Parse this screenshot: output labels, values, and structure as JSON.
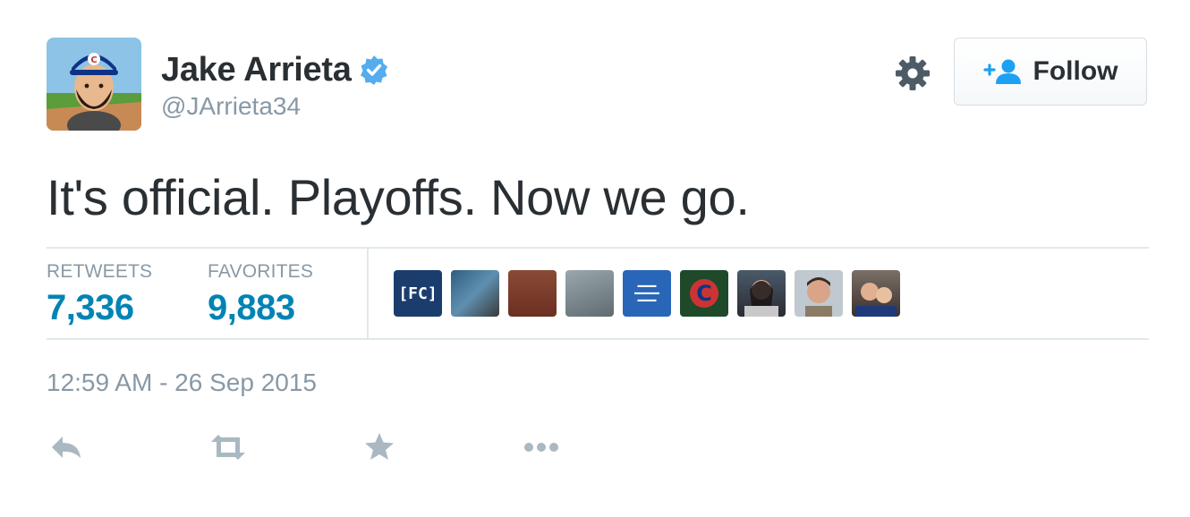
{
  "user": {
    "name": "Jake Arrieta",
    "handle": "@JArrieta34",
    "verified": true,
    "avatar_icon": "cartoon-baseball-player-avatar"
  },
  "header": {
    "settings_icon": "gear-icon",
    "follow_label": "Follow",
    "follow_icon": "add-user-icon"
  },
  "tweet": {
    "text": "It's official. Playoffs. Now we go."
  },
  "stats": {
    "retweets_label": "RETWEETS",
    "retweets_value": "7,336",
    "favorites_label": "FAVORITES",
    "favorites_value": "9,883"
  },
  "favoriters": [
    {
      "icon": "fantasy-cruncher-logo",
      "text": "[FC]",
      "color": "#1b3d6e"
    },
    {
      "icon": "user-photo",
      "color": "#3d6f8f"
    },
    {
      "icon": "user-photo",
      "color": "#7a3d2b"
    },
    {
      "icon": "user-photo",
      "color": "#6f7f86"
    },
    {
      "icon": "quote-poster",
      "color": "#2a66b8"
    },
    {
      "icon": "cubs-logo",
      "text": "C",
      "color": "#1f4a2a"
    },
    {
      "icon": "user-photo",
      "color": "#3b3a44"
    },
    {
      "icon": "user-photo",
      "color": "#8b7a66"
    },
    {
      "icon": "user-photo",
      "color": "#5a3a3a"
    }
  ],
  "meta": {
    "timestamp": "12:59 AM - 26 Sep 2015"
  },
  "actions": {
    "reply_icon": "reply-icon",
    "retweet_icon": "retweet-icon",
    "favorite_icon": "star-icon",
    "more_icon": "more-icon"
  },
  "colors": {
    "accent": "#0084b4",
    "muted": "#8899a6",
    "verified": "#55acee"
  }
}
